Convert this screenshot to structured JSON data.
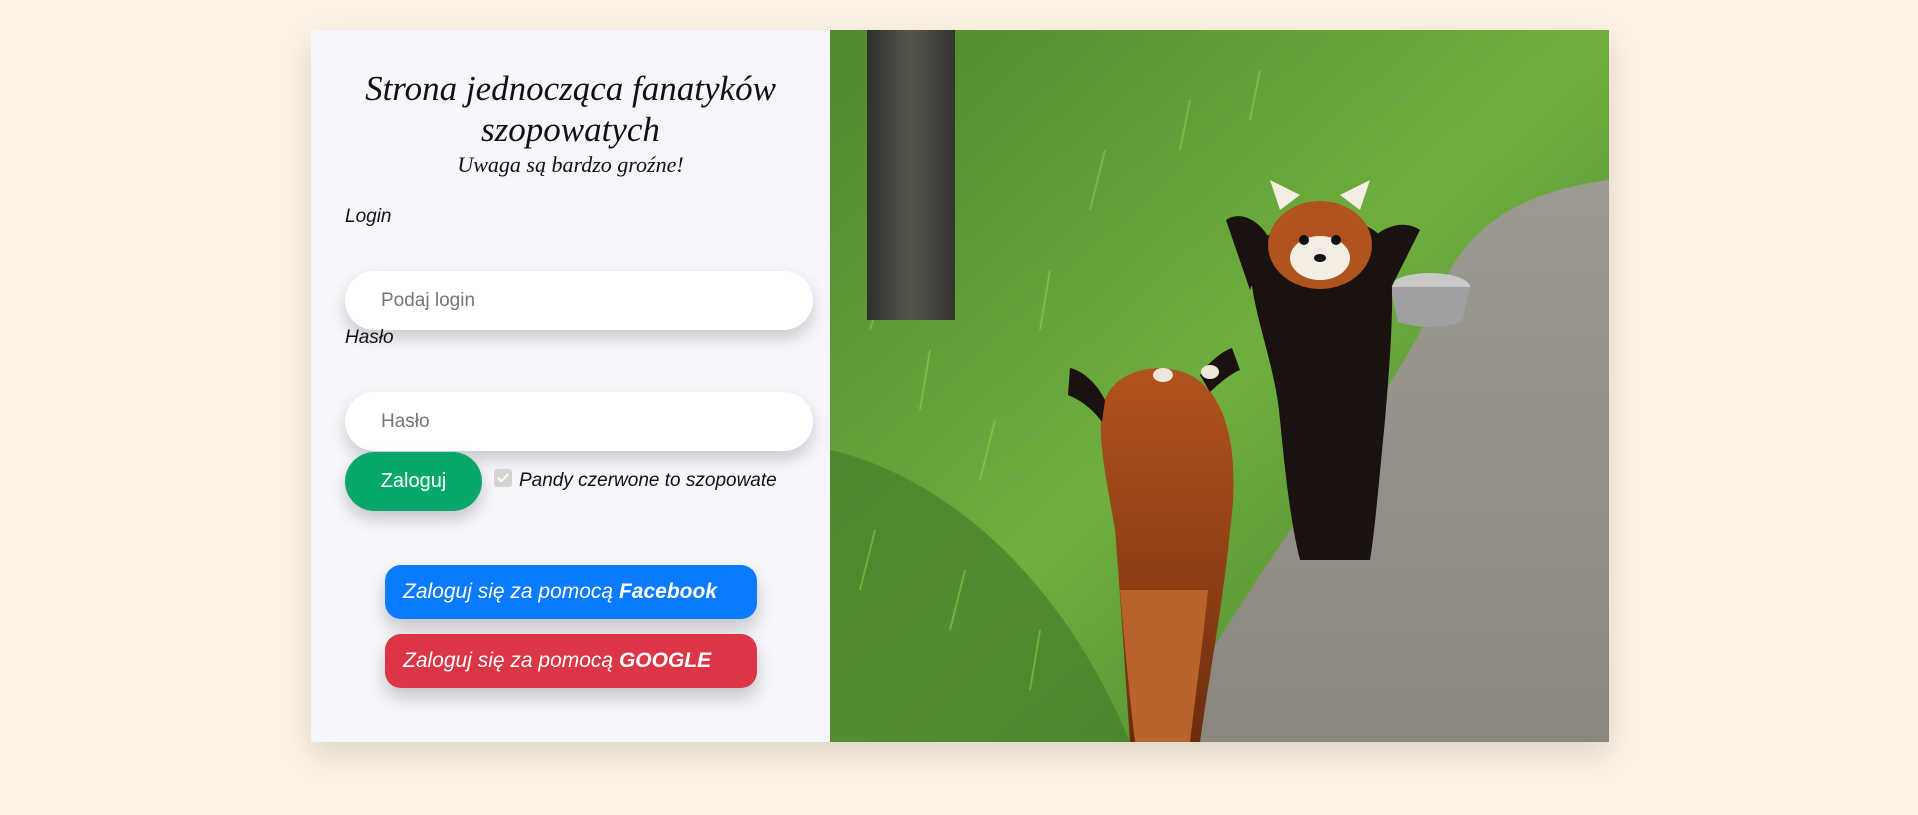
{
  "header": {
    "title": "Strona jednocząca fanatyków szopowatych",
    "subtitle": "Uwaga są bardzo groźne!"
  },
  "form": {
    "login_label": "Login",
    "login_placeholder": "Podaj login",
    "password_label": "Hasło",
    "password_placeholder": "Hasło",
    "submit_label": "Zaloguj",
    "checkbox_label": "Pandy czerwone to szopowate",
    "checkbox_checked": true
  },
  "social": {
    "prefix": "Zaloguj się za pomocą",
    "facebook_name": "Facebook",
    "google_name": "GOOGLE",
    "facebook_color": "#0a7bff",
    "google_color": "#dc3545"
  },
  "image": {
    "subject": "two red pandas standing on hind legs"
  },
  "colors": {
    "background": "#fdf1e3",
    "panel": "#f5f6fc",
    "submit": "#07a96a"
  }
}
